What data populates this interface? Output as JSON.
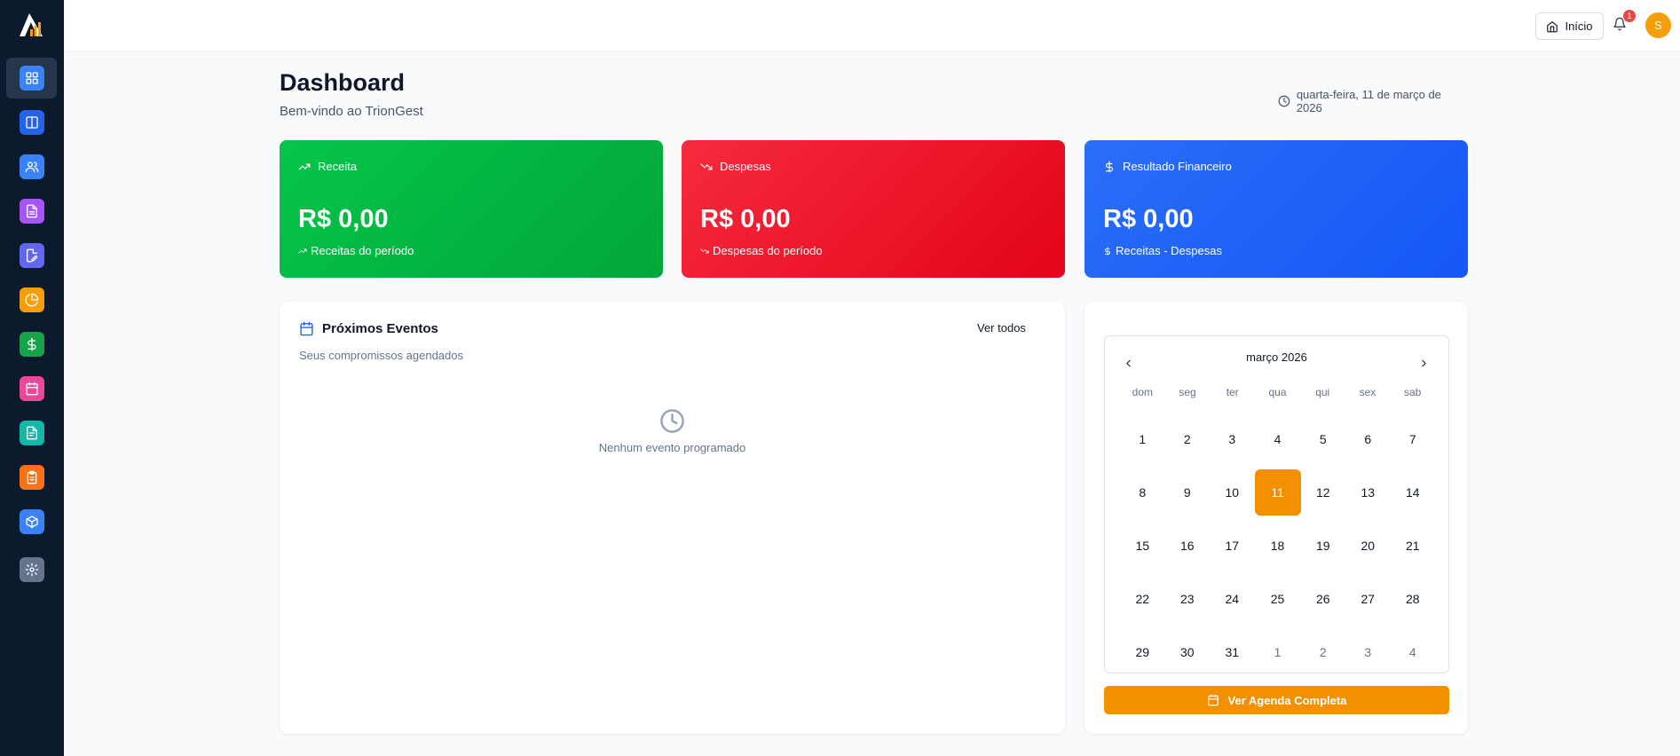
{
  "app": {
    "logo_icon": "triongest-logo-icon"
  },
  "sidebar": {
    "items": [
      {
        "icon": "dashboard-grid-icon",
        "color": "#3b82f6",
        "active": true
      },
      {
        "icon": "panel-columns-icon",
        "color": "#2563eb"
      },
      {
        "icon": "users-icon",
        "color": "#3b82f6"
      },
      {
        "icon": "document-icon",
        "color": "#a855f7"
      },
      {
        "icon": "edit-document-icon",
        "color": "#6366f1"
      },
      {
        "icon": "pie-chart-icon",
        "color": "#f59e0b"
      },
      {
        "icon": "dollar-icon",
        "color": "#16a34a"
      },
      {
        "icon": "calendar-icon",
        "color": "#ec4899"
      },
      {
        "icon": "file-text-icon",
        "color": "#14b8a6"
      },
      {
        "icon": "clipboard-icon",
        "color": "#f97316"
      },
      {
        "icon": "box-icon",
        "color": "#3b82f6"
      },
      {
        "icon": "settings-icon",
        "color": "#64748b"
      }
    ]
  },
  "topbar": {
    "home_label": "Início",
    "notification_count": "1",
    "avatar_initial": "S"
  },
  "header": {
    "title": "Dashboard",
    "subtitle": "Bem-vindo ao TrionGest",
    "date": "quarta-feira, 11 de março de 2026"
  },
  "stats": {
    "revenue": {
      "label": "Receita",
      "value": "R$ 0,00",
      "footer": "Receitas do período",
      "color": "#02b540"
    },
    "expenses": {
      "label": "Despesas",
      "value": "R$ 0,00",
      "footer": "Despesas do período",
      "color": "#ef1629"
    },
    "result": {
      "label": "Resultado Financeiro",
      "value": "R$ 0,00",
      "footer": "Receitas - Despesas",
      "color": "#1f63f7"
    }
  },
  "events": {
    "title": "Próximos Eventos",
    "subtitle": "Seus compromissos agendados",
    "see_all": "Ver todos",
    "empty_text": "Nenhum evento programado"
  },
  "calendar": {
    "month_label": "março 2026",
    "weekdays": [
      "dom",
      "seg",
      "ter",
      "qua",
      "qui",
      "sex",
      "sab"
    ],
    "days": [
      "1",
      "2",
      "3",
      "4",
      "5",
      "6",
      "7",
      "8",
      "9",
      "10",
      "11",
      "12",
      "13",
      "14",
      "15",
      "16",
      "17",
      "18",
      "19",
      "20",
      "21",
      "22",
      "23",
      "24",
      "25",
      "26",
      "27",
      "28",
      "29",
      "30",
      "31",
      "1",
      "2",
      "3",
      "4"
    ],
    "today_index": 10,
    "outside_from_index": 31,
    "accent": "#f29000",
    "button_label": "Ver Agenda Completa"
  }
}
